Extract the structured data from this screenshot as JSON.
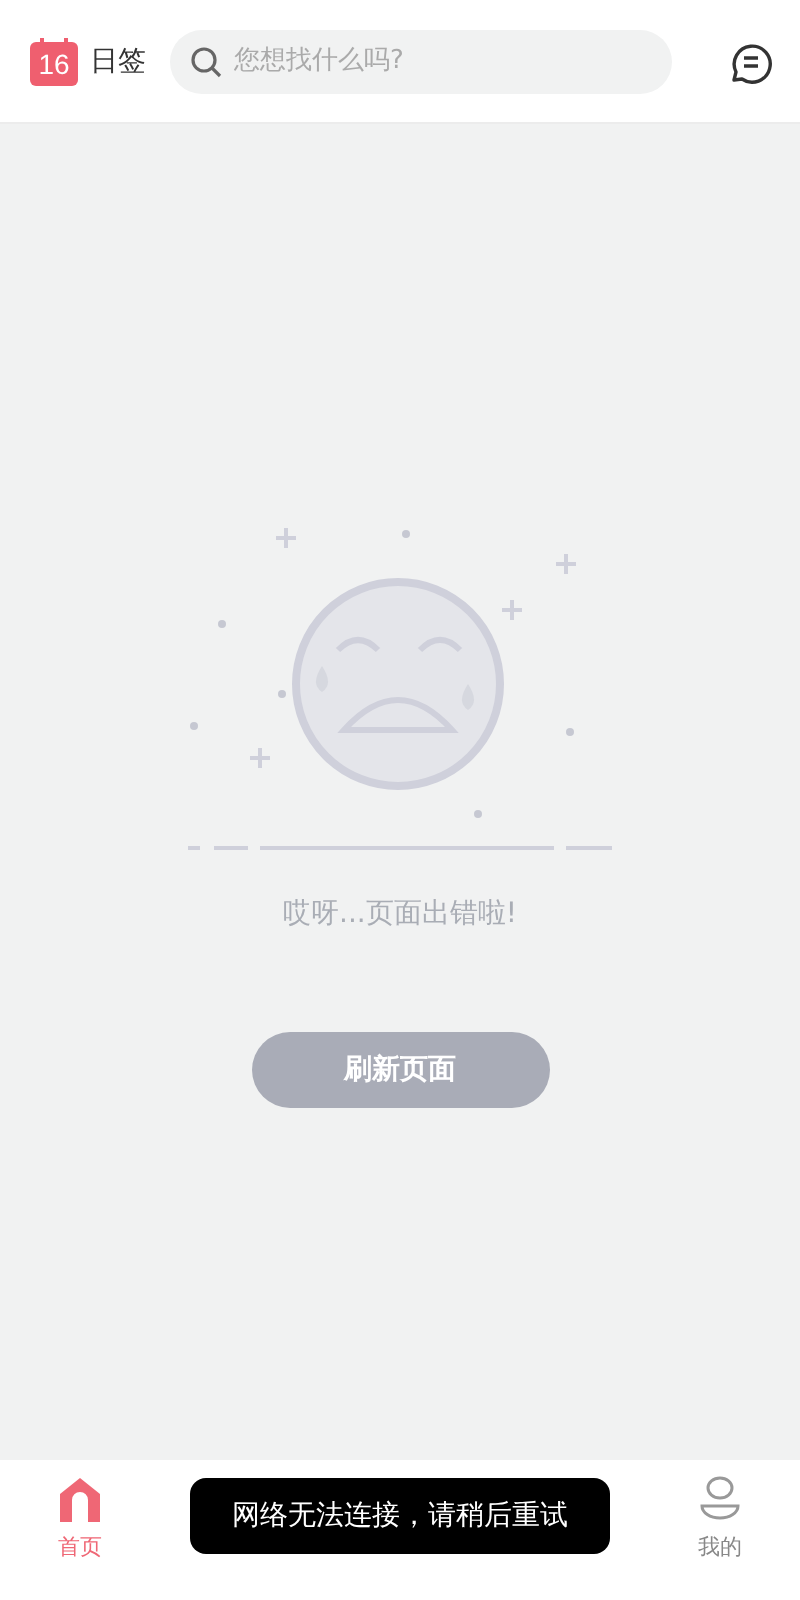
{
  "header": {
    "logo_day": "16",
    "app_name": "日签",
    "search": {
      "placeholder": "您想找什么吗?"
    }
  },
  "error": {
    "message": "哎呀...页面出错啦!",
    "button": "刷新页面"
  },
  "tabs": [
    {
      "label": "首页",
      "kind": "home",
      "selected": true
    },
    {
      "label": "我的",
      "kind": "profile",
      "selected": false
    }
  ],
  "toast": "网络无法连接，请稍后重试"
}
